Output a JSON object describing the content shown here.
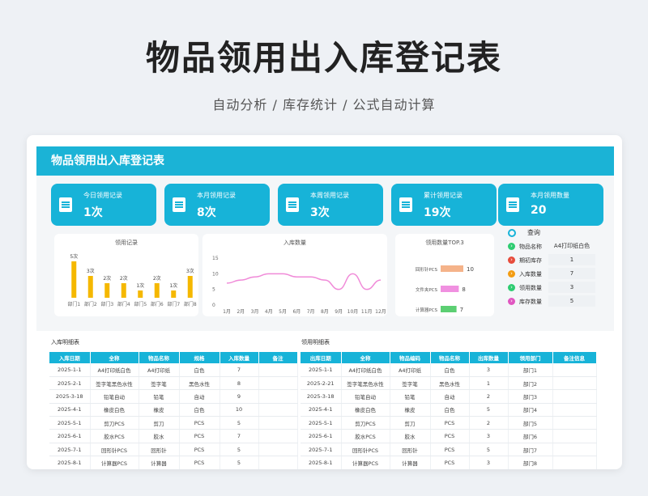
{
  "hero": {
    "title": "物品领用出入库登记表",
    "subtitle": "自动分析 / 库存统计 / 公式自动计算"
  },
  "banner": {
    "title": "物品领用出入库登记表"
  },
  "kpis": [
    {
      "label": "今日领用记录",
      "value": "1次"
    },
    {
      "label": "本月领用记录",
      "value": "8次"
    },
    {
      "label": "本周领用记录",
      "value": "3次"
    },
    {
      "label": "累计领用记录",
      "value": "19次"
    },
    {
      "label": "本月领用数量",
      "value": "20"
    }
  ],
  "lookup": {
    "title": "查询",
    "rows": [
      {
        "key": "物品名称",
        "value": "A4打印纸白色",
        "color": "#ffffff"
      },
      {
        "key": "期初库存",
        "value": "1",
        "color": "#e74c3c"
      },
      {
        "key": "入库数量",
        "value": "7",
        "color": "#f39c12"
      },
      {
        "key": "领用数量",
        "value": "3",
        "color": "#2ecc71"
      },
      {
        "key": "库存数量",
        "value": "5",
        "color": "#e056c0"
      }
    ]
  },
  "colors": {
    "accent": "#17b3d8",
    "bar": "#f5b800",
    "line": "#f08ad8"
  },
  "chart_data": [
    {
      "type": "bar",
      "title": "领用记录",
      "categories": [
        "部门1",
        "部门2",
        "部门3",
        "部门4",
        "部门5",
        "部门6",
        "部门7",
        "部门8"
      ],
      "values": [
        5,
        3,
        2,
        2,
        1,
        2,
        1,
        3
      ],
      "data_labels": [
        "5次",
        "3次",
        "2次",
        "2次",
        "1次",
        "2次",
        "1次",
        "3次"
      ],
      "ylim": [
        0,
        5
      ]
    },
    {
      "type": "line",
      "title": "入库数量",
      "x": [
        "1月",
        "2月",
        "3月",
        "4月",
        "5月",
        "6月",
        "7月",
        "8月",
        "9月",
        "10月",
        "11月",
        "12月"
      ],
      "values": [
        7,
        8,
        9,
        10,
        10,
        9,
        9,
        8,
        5,
        10,
        5,
        8
      ],
      "yticks": [
        "0",
        "5",
        "10",
        "15"
      ],
      "ylim": [
        0,
        15
      ]
    },
    {
      "type": "bar",
      "orientation": "horizontal",
      "title": "领用数量TOP.3",
      "categories": [
        "回形针PCS",
        "文件夹PCS",
        "计算器PCS"
      ],
      "values": [
        10,
        8,
        7
      ],
      "bar_colors": [
        "#f5b38a",
        "#f090e0",
        "#5ccf73"
      ]
    }
  ],
  "inbound": {
    "title": "入库明细表",
    "headers": [
      "入库日期",
      "全称",
      "物品名称",
      "规格",
      "入库数量",
      "备注"
    ],
    "rows": [
      [
        "2025-1-1",
        "A4打印纸白色",
        "A4打印纸",
        "白色",
        "7",
        ""
      ],
      [
        "2025-2-1",
        "签字笔黑色水性",
        "签字笔",
        "黑色水性",
        "8",
        ""
      ],
      [
        "2025-3-18",
        "铅笔自动",
        "铅笔",
        "自动",
        "9",
        ""
      ],
      [
        "2025-4-1",
        "橡皮白色",
        "橡皮",
        "白色",
        "10",
        ""
      ],
      [
        "2025-5-1",
        "剪刀PCS",
        "剪刀",
        "PCS",
        "5",
        ""
      ],
      [
        "2025-6-1",
        "胶水PCS",
        "胶水",
        "PCS",
        "7",
        ""
      ],
      [
        "2025-7-1",
        "回形针PCS",
        "回形针",
        "PCS",
        "5",
        ""
      ],
      [
        "2025-8-1",
        "计算器PCS",
        "计算器",
        "PCS",
        "5",
        ""
      ]
    ]
  },
  "outbound": {
    "title": "领用明细表",
    "headers": [
      "出库日期",
      "全称",
      "物品编码",
      "物品名称",
      "出库数量",
      "领用部门",
      "备注信息"
    ],
    "rows": [
      [
        "2025-1-1",
        "A4打印纸白色",
        "A4打印纸",
        "白色",
        "3",
        "部门1",
        ""
      ],
      [
        "2025-2-21",
        "签字笔黑色水性",
        "签字笔",
        "黑色水性",
        "1",
        "部门2",
        ""
      ],
      [
        "2025-3-18",
        "铅笔自动",
        "铅笔",
        "自动",
        "2",
        "部门3",
        ""
      ],
      [
        "2025-4-1",
        "橡皮白色",
        "橡皮",
        "白色",
        "5",
        "部门4",
        ""
      ],
      [
        "2025-5-1",
        "剪刀PCS",
        "剪刀",
        "PCS",
        "2",
        "部门5",
        ""
      ],
      [
        "2025-6-1",
        "胶水PCS",
        "胶水",
        "PCS",
        "3",
        "部门6",
        ""
      ],
      [
        "2025-7-1",
        "回形针PCS",
        "回形针",
        "PCS",
        "5",
        "部门7",
        ""
      ],
      [
        "2025-8-1",
        "计算器PCS",
        "计算器",
        "PCS",
        "3",
        "部门8",
        ""
      ]
    ]
  }
}
